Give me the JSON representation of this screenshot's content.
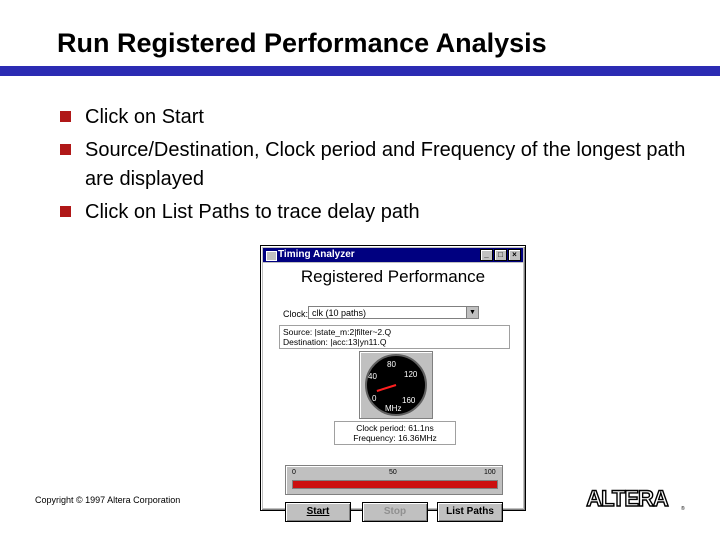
{
  "slide": {
    "title": "Run Registered Performance Analysis",
    "bullets": [
      "Click on Start",
      "Source/Destination, Clock period and Frequency of the longest path are displayed",
      "Click on List Paths to trace delay path"
    ],
    "copyright": "Copyright © 1997 Altera Corporation",
    "logo_text": "ALTERA"
  },
  "window": {
    "title": "Timing Analyzer",
    "heading": "Registered Performance",
    "clock_label": "Clock:",
    "clock_value": "clk (10 paths)",
    "source": "Source: |state_m:2|filter~2.Q",
    "destination": "Destination: |acc:13|yn11.Q",
    "gauge": {
      "unit": "MHz",
      "ticks": [
        "0",
        "40",
        "80",
        "120",
        "160"
      ],
      "value_mhz": 16.36,
      "max_mhz": 160
    },
    "clock_period": "Clock period: 61.1ns",
    "frequency": "Frequency: 16.36MHz",
    "progress": {
      "ticks": [
        "0",
        "50",
        "100"
      ],
      "value_percent": 100
    },
    "buttons": {
      "start": "Start",
      "stop": "Stop",
      "list_paths": "List Paths"
    }
  },
  "colors": {
    "title_rule": "#2b2bb3",
    "bullet": "#b01818",
    "titlebar": "#000080",
    "progress": "#cc1010"
  }
}
